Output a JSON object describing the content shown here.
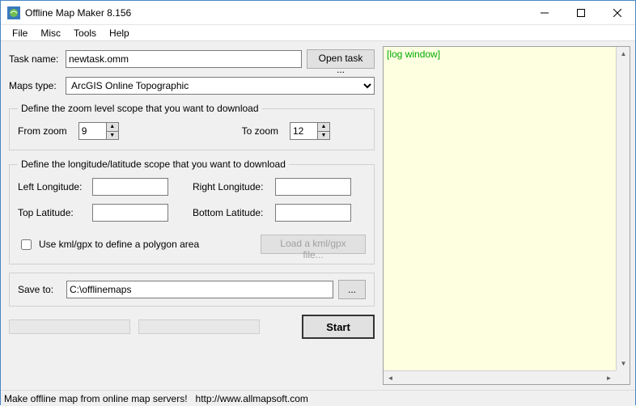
{
  "window": {
    "title": "Offline Map Maker 8.156"
  },
  "menu": {
    "file": "File",
    "misc": "Misc",
    "tools": "Tools",
    "help": "Help"
  },
  "task": {
    "label": "Task name:",
    "value": "newtask.omm",
    "open_btn": "Open task ..."
  },
  "maps": {
    "label": "Maps type:",
    "selected": "ArcGIS Online Topographic"
  },
  "zoom_group": {
    "legend": "Define the zoom level scope that you want to download",
    "from_label": "From zoom",
    "from_value": "9",
    "to_label": "To zoom",
    "to_value": "12"
  },
  "ll_group": {
    "legend": "Define the longitude/latitude scope that you want to download",
    "left_lon_label": "Left Longitude:",
    "left_lon_value": "",
    "right_lon_label": "Right Longitude:",
    "right_lon_value": "",
    "top_lat_label": "Top Latitude:",
    "top_lat_value": "",
    "bottom_lat_label": "Bottom Latitude:",
    "bottom_lat_value": "",
    "use_kml_label": "Use kml/gpx to define a polygon area",
    "load_kml_btn": "Load a kml/gpx file..."
  },
  "save": {
    "label": "Save to:",
    "value": "C:\\offlinemaps",
    "browse_btn": "..."
  },
  "start_btn": "Start",
  "log": {
    "placeholder": "[log window]"
  },
  "status": {
    "text": "Make offline map from online map servers!",
    "url": "http://www.allmapsoft.com"
  }
}
